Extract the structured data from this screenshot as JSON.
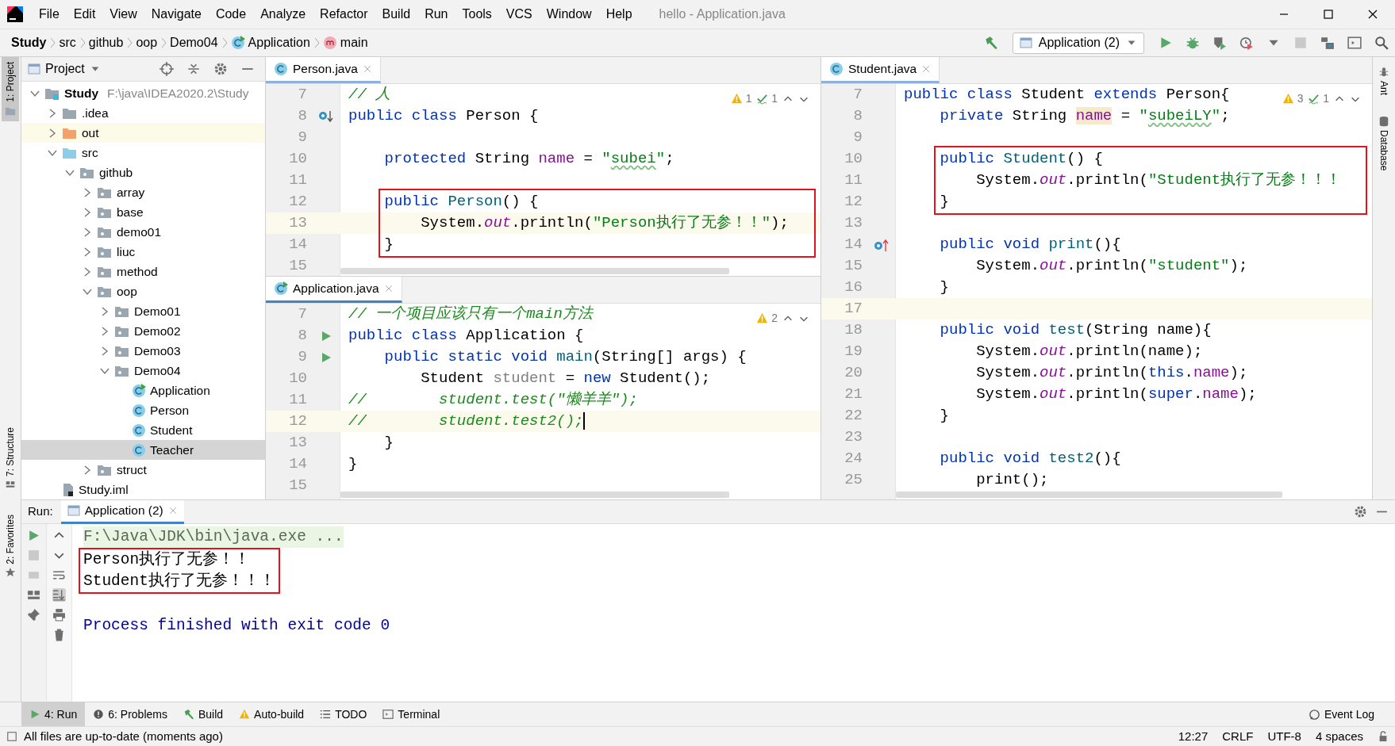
{
  "title_bar": {
    "menu": [
      "File",
      "Edit",
      "View",
      "Navigate",
      "Code",
      "Analyze",
      "Refactor",
      "Build",
      "Run",
      "Tools",
      "VCS",
      "Window",
      "Help"
    ],
    "title": "hello - Application.java"
  },
  "breadcrumbs": [
    {
      "label": "Study",
      "kind": "project"
    },
    {
      "label": "src",
      "kind": "folder"
    },
    {
      "label": "github",
      "kind": "folder"
    },
    {
      "label": "oop",
      "kind": "folder"
    },
    {
      "label": "Demo04",
      "kind": "folder"
    },
    {
      "label": "Application",
      "kind": "class"
    },
    {
      "label": "main",
      "kind": "method"
    }
  ],
  "run_config": {
    "label": "Application (2)"
  },
  "left_stripe": [
    "1: Project",
    "7: Structure",
    "2: Favorites"
  ],
  "right_stripe": [
    "Ant",
    "Database"
  ],
  "project_panel": {
    "title": "Project",
    "tree": [
      {
        "label": "Study",
        "path": "F:\\java\\IDEA2020.2\\Study",
        "kind": "project",
        "expanded": true,
        "selected": false,
        "children": [
          {
            "label": ".idea",
            "kind": "folder",
            "expanded": false,
            "selected": false
          },
          {
            "label": "out",
            "kind": "excluded",
            "expanded": false,
            "selected": false
          },
          {
            "label": "src",
            "kind": "source",
            "expanded": true,
            "selected": false,
            "children": [
              {
                "label": "github",
                "kind": "package",
                "expanded": true,
                "selected": false,
                "children": [
                  {
                    "label": "array",
                    "kind": "package",
                    "expanded": false,
                    "selected": false
                  },
                  {
                    "label": "base",
                    "kind": "package",
                    "expanded": false,
                    "selected": false
                  },
                  {
                    "label": "demo01",
                    "kind": "package",
                    "expanded": false,
                    "selected": false
                  },
                  {
                    "label": "liuc",
                    "kind": "package",
                    "expanded": false,
                    "selected": false
                  },
                  {
                    "label": "method",
                    "kind": "package",
                    "expanded": false,
                    "selected": false
                  },
                  {
                    "label": "oop",
                    "kind": "package",
                    "expanded": true,
                    "selected": false,
                    "children": [
                      {
                        "label": "Demo01",
                        "kind": "package",
                        "expanded": false,
                        "selected": false
                      },
                      {
                        "label": "Demo02",
                        "kind": "package",
                        "expanded": false,
                        "selected": false
                      },
                      {
                        "label": "Demo03",
                        "kind": "package",
                        "expanded": false,
                        "selected": false
                      },
                      {
                        "label": "Demo04",
                        "kind": "package",
                        "expanded": true,
                        "selected": false,
                        "children": [
                          {
                            "label": "Application",
                            "kind": "runnable",
                            "selected": false
                          },
                          {
                            "label": "Person",
                            "kind": "class",
                            "selected": false
                          },
                          {
                            "label": "Student",
                            "kind": "class",
                            "selected": false
                          },
                          {
                            "label": "Teacher",
                            "kind": "class",
                            "selected": true
                          }
                        ]
                      }
                    ]
                  },
                  {
                    "label": "struct",
                    "kind": "package",
                    "expanded": false,
                    "selected": false
                  }
                ]
              }
            ]
          },
          {
            "label": "Study.iml",
            "kind": "file",
            "selected": false
          }
        ]
      }
    ]
  },
  "editor_groups": [
    [
      {
        "tab": {
          "label": "Person.java",
          "kind": "class"
        },
        "focused": false,
        "inspections": [
          {
            "kind": "warning",
            "count": "1"
          },
          {
            "kind": "weak",
            "count": "1"
          }
        ],
        "lines": [
          {
            "number": "7",
            "tokens": [
              {
                "text": "// 人",
                "kind": "comment"
              }
            ],
            "current": false,
            "boxed": false
          },
          {
            "number": "8",
            "gutter_icon": {
              "kind": "implemented"
            },
            "tokens": [
              {
                "text": "public class ",
                "kind": "kw"
              },
              {
                "text": "Person {",
                "kind": "plain"
              }
            ],
            "current": false,
            "boxed": false
          },
          {
            "number": "9",
            "current": false,
            "boxed": false
          },
          {
            "number": "10",
            "tokens": [
              {
                "text": "    protected ",
                "kind": "kw"
              },
              {
                "text": "String ",
                "kind": "plain"
              },
              {
                "text": "name",
                "kind": "field"
              },
              {
                "text": " = ",
                "kind": "plain"
              },
              {
                "text": "\"",
                "kind": "str"
              },
              {
                "text": "subei",
                "kind": "str-typo"
              },
              {
                "text": "\"",
                "kind": "str"
              },
              {
                "text": ";",
                "kind": "plain"
              }
            ],
            "current": false,
            "boxed": false
          },
          {
            "number": "11",
            "current": false,
            "boxed": false
          },
          {
            "number": "12",
            "tokens": [
              {
                "text": "    public ",
                "kind": "kw"
              },
              {
                "text": "Person",
                "kind": "method"
              },
              {
                "text": "() {",
                "kind": "plain"
              }
            ],
            "current": false,
            "boxed": true
          },
          {
            "number": "13",
            "tokens": [
              {
                "text": "        System.",
                "kind": "plain"
              },
              {
                "text": "out",
                "kind": "static"
              },
              {
                "text": ".println(",
                "kind": "plain"
              },
              {
                "text": "\"Person执行了无参！！\"",
                "kind": "str"
              },
              {
                "text": ");",
                "kind": "plain"
              }
            ],
            "current": true,
            "boxed": true
          },
          {
            "number": "14",
            "tokens": [
              {
                "text": "    }",
                "kind": "plain"
              }
            ],
            "current": false,
            "boxed": true
          },
          {
            "number": "15",
            "current": false,
            "boxed": false
          }
        ]
      },
      {
        "tab": {
          "label": "Application.java",
          "kind": "runnable"
        },
        "focused": true,
        "inspections": [
          {
            "kind": "warning",
            "count": "2"
          }
        ],
        "lines": [
          {
            "number": "7",
            "tokens": [
              {
                "text": "// 一个项目应该只有一个main方法",
                "kind": "comment"
              }
            ],
            "current": false,
            "boxed": false
          },
          {
            "number": "8",
            "gutter_icon": {
              "kind": "run"
            },
            "tokens": [
              {
                "text": "public class ",
                "kind": "kw"
              },
              {
                "text": "Application {",
                "kind": "plain"
              }
            ],
            "current": false,
            "boxed": false
          },
          {
            "number": "9",
            "gutter_icon": {
              "kind": "run"
            },
            "tokens": [
              {
                "text": "    public static void ",
                "kind": "kw"
              },
              {
                "text": "main",
                "kind": "method"
              },
              {
                "text": "(String[] args) {",
                "kind": "plain"
              }
            ],
            "current": false,
            "boxed": false
          },
          {
            "number": "10",
            "tokens": [
              {
                "text": "        Student ",
                "kind": "plain"
              },
              {
                "text": "student",
                "kind": "unused"
              },
              {
                "text": " = ",
                "kind": "plain"
              },
              {
                "text": "new ",
                "kind": "kw"
              },
              {
                "text": "Student();",
                "kind": "plain"
              }
            ],
            "current": false,
            "boxed": false
          },
          {
            "number": "11",
            "tokens": [
              {
                "text": "//        student.test(\"懒羊羊\");",
                "kind": "comment"
              }
            ],
            "current": false,
            "boxed": false
          },
          {
            "number": "12",
            "tokens": [
              {
                "text": "//        student.test2();",
                "kind": "comment"
              }
            ],
            "current": true,
            "boxed": false
          },
          {
            "number": "13",
            "tokens": [
              {
                "text": "    }",
                "kind": "plain"
              }
            ],
            "current": false,
            "boxed": false
          },
          {
            "number": "14",
            "tokens": [
              {
                "text": "}",
                "kind": "plain"
              }
            ],
            "current": false,
            "boxed": false
          },
          {
            "number": "15",
            "current": false,
            "boxed": false
          }
        ]
      }
    ],
    [
      {
        "tab": {
          "label": "Student.java",
          "kind": "class"
        },
        "focused": false,
        "inspections": [
          {
            "kind": "warning",
            "count": "3"
          },
          {
            "kind": "weak",
            "count": "1"
          }
        ],
        "lines": [
          {
            "number": "7",
            "tokens": [
              {
                "text": "public class ",
                "kind": "kw"
              },
              {
                "text": "Student ",
                "kind": "plain"
              },
              {
                "text": "extends ",
                "kind": "kw"
              },
              {
                "text": "Person{",
                "kind": "plain"
              }
            ],
            "current": false,
            "boxed": false
          },
          {
            "number": "8",
            "tokens": [
              {
                "text": "    private ",
                "kind": "kw"
              },
              {
                "text": "String ",
                "kind": "plain"
              },
              {
                "text": "name",
                "kind": "field-hl"
              },
              {
                "text": " = ",
                "kind": "plain"
              },
              {
                "text": "\"",
                "kind": "str"
              },
              {
                "text": "subeiLY",
                "kind": "str-typo"
              },
              {
                "text": "\"",
                "kind": "str"
              },
              {
                "text": ";",
                "kind": "plain"
              }
            ],
            "current": false,
            "boxed": false
          },
          {
            "number": "9",
            "current": false,
            "boxed": false
          },
          {
            "number": "10",
            "tokens": [
              {
                "text": "    public ",
                "kind": "kw"
              },
              {
                "text": "Student",
                "kind": "method"
              },
              {
                "text": "() {",
                "kind": "plain"
              }
            ],
            "current": false,
            "boxed": true
          },
          {
            "number": "11",
            "tokens": [
              {
                "text": "        System.",
                "kind": "plain"
              },
              {
                "text": "out",
                "kind": "static"
              },
              {
                "text": ".println(",
                "kind": "plain"
              },
              {
                "text": "\"Student执行了无参！！！",
                "kind": "str"
              }
            ],
            "current": false,
            "boxed": true
          },
          {
            "number": "12",
            "tokens": [
              {
                "text": "    }",
                "kind": "plain"
              }
            ],
            "current": false,
            "boxed": true
          },
          {
            "number": "13",
            "current": false,
            "boxed": false
          },
          {
            "number": "14",
            "gutter_icon": {
              "kind": "overrides"
            },
            "tokens": [
              {
                "text": "    public void ",
                "kind": "kw"
              },
              {
                "text": "print",
                "kind": "method"
              },
              {
                "text": "(){",
                "kind": "plain"
              }
            ],
            "current": false,
            "boxed": false
          },
          {
            "number": "15",
            "tokens": [
              {
                "text": "        System.",
                "kind": "plain"
              },
              {
                "text": "out",
                "kind": "static"
              },
              {
                "text": ".println(",
                "kind": "plain"
              },
              {
                "text": "\"student\"",
                "kind": "str"
              },
              {
                "text": ");",
                "kind": "plain"
              }
            ],
            "current": false,
            "boxed": false
          },
          {
            "number": "16",
            "tokens": [
              {
                "text": "    }",
                "kind": "plain"
              }
            ],
            "current": false,
            "boxed": false
          },
          {
            "number": "17",
            "current": true,
            "boxed": false
          },
          {
            "number": "18",
            "tokens": [
              {
                "text": "    public void ",
                "kind": "kw"
              },
              {
                "text": "test",
                "kind": "method"
              },
              {
                "text": "(String name){",
                "kind": "plain"
              }
            ],
            "current": false,
            "boxed": false
          },
          {
            "number": "19",
            "tokens": [
              {
                "text": "        System.",
                "kind": "plain"
              },
              {
                "text": "out",
                "kind": "static"
              },
              {
                "text": ".println(name);",
                "kind": "plain"
              }
            ],
            "current": false,
            "boxed": false
          },
          {
            "number": "20",
            "tokens": [
              {
                "text": "        System.",
                "kind": "plain"
              },
              {
                "text": "out",
                "kind": "static"
              },
              {
                "text": ".println(",
                "kind": "plain"
              },
              {
                "text": "this",
                "kind": "kw"
              },
              {
                "text": ".",
                "kind": "plain"
              },
              {
                "text": "name",
                "kind": "field"
              },
              {
                "text": ");",
                "kind": "plain"
              }
            ],
            "current": false,
            "boxed": false
          },
          {
            "number": "21",
            "tokens": [
              {
                "text": "        System.",
                "kind": "plain"
              },
              {
                "text": "out",
                "kind": "static"
              },
              {
                "text": ".println(",
                "kind": "plain"
              },
              {
                "text": "super",
                "kind": "kw"
              },
              {
                "text": ".",
                "kind": "plain"
              },
              {
                "text": "name",
                "kind": "field"
              },
              {
                "text": ");",
                "kind": "plain"
              }
            ],
            "current": false,
            "boxed": false
          },
          {
            "number": "22",
            "tokens": [
              {
                "text": "    }",
                "kind": "plain"
              }
            ],
            "current": false,
            "boxed": false
          },
          {
            "number": "23",
            "current": false,
            "boxed": false
          },
          {
            "number": "24",
            "tokens": [
              {
                "text": "    public void ",
                "kind": "kw"
              },
              {
                "text": "test2",
                "kind": "method"
              },
              {
                "text": "(){",
                "kind": "plain"
              }
            ],
            "current": false,
            "boxed": false
          },
          {
            "number": "25",
            "tokens": [
              {
                "text": "        print();",
                "kind": "plain"
              }
            ],
            "current": false,
            "boxed": false
          }
        ]
      }
    ]
  ],
  "run_panel": {
    "label": "Run:",
    "tab": "Application (2)",
    "output": [
      {
        "text": "F:\\Java\\JDK\\bin\\java.exe ...",
        "kind": "command",
        "boxed": false
      },
      {
        "text": "Person执行了无参！！",
        "kind": "stdout",
        "boxed": true
      },
      {
        "text": "Student执行了无参！！！",
        "kind": "stdout",
        "boxed": true
      },
      {
        "text": "Process finished with exit code 0",
        "kind": "system",
        "boxed": false
      }
    ]
  },
  "tool_windows": [
    {
      "label": "4: Run",
      "kind": "run",
      "selected": true
    },
    {
      "label": "6: Problems",
      "kind": "problems",
      "selected": false
    },
    {
      "label": "Build",
      "kind": "build",
      "selected": false
    },
    {
      "label": "Auto-build",
      "kind": "warning",
      "selected": false
    },
    {
      "label": "TODO",
      "kind": "todo",
      "selected": false
    },
    {
      "label": "Terminal",
      "kind": "terminal",
      "selected": false
    }
  ],
  "event_log": "Event Log",
  "status_bar": {
    "message": "All files are up-to-date (moments ago)",
    "items": [
      "12:27",
      "CRLF",
      "UTF-8",
      "4 spaces"
    ]
  }
}
